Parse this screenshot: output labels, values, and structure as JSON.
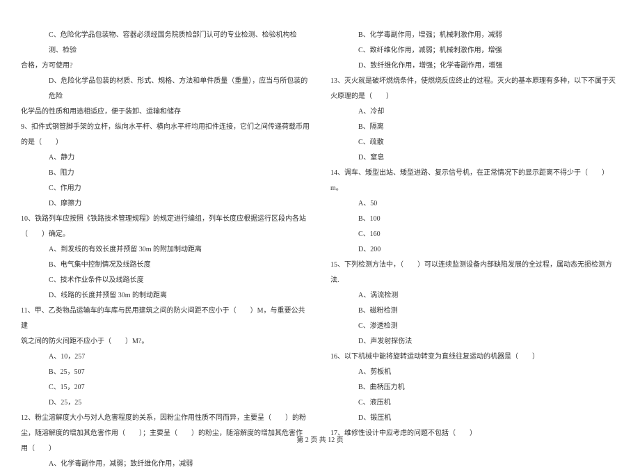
{
  "left_column": [
    {
      "type": "option",
      "text": "C、危险化学品包装物、容器必须经国务院质检部门认可的专业检测、检验机构检测、检验"
    },
    {
      "type": "question",
      "text": "合格，方可使用?"
    },
    {
      "type": "option",
      "text": "D、危险化学品包装的材质、形式、规格、方法和单件质量（重量），应当与所包装的危险"
    },
    {
      "type": "question",
      "text": "化学品的性质和用途相适应，便于装卸、运输和储存"
    },
    {
      "type": "question",
      "text": "9、扣件式钢管脚手架的立杆，纵向水平杆、横向水平杆均用扣件连接，它们之间传递荷载币用"
    },
    {
      "type": "question",
      "text": "的是（　　）"
    },
    {
      "type": "option",
      "text": "A、静力"
    },
    {
      "type": "option",
      "text": "B、阻力"
    },
    {
      "type": "option",
      "text": "C、作用力"
    },
    {
      "type": "option",
      "text": "D、摩擦力"
    },
    {
      "type": "question",
      "text": "10、铁路列车应按照《铁路技术管理规程》的规定进行编组，列车长度应根据运行区段内各站"
    },
    {
      "type": "question",
      "text": "（　　）确定。"
    },
    {
      "type": "option",
      "text": "A、到发线的有效长度并预留 30m 的附加制动距离"
    },
    {
      "type": "option",
      "text": "B、电气集中控制情况及线路长度"
    },
    {
      "type": "option",
      "text": "C、技术作业条件以及线路长度"
    },
    {
      "type": "option",
      "text": "D、线路的长度并预留 30m 的制动距离"
    },
    {
      "type": "question",
      "text": "11、甲、乙类物品运输车的车库与民用建筑之间的防火间距不应小于（　　）M，与重要公共建"
    },
    {
      "type": "question",
      "text": "筑之间的防火间距不应小于（　　）M?。"
    },
    {
      "type": "option",
      "text": "A、10，257"
    },
    {
      "type": "option",
      "text": "B、25，507"
    },
    {
      "type": "option",
      "text": "C、15，207"
    },
    {
      "type": "option",
      "text": "D、25，25"
    },
    {
      "type": "question",
      "text": "12、粉尘溶解度大小与对人危害程度的关系，因粉尘作用性质不同而异，主要呈（　　）的粉"
    },
    {
      "type": "question",
      "text": "尘，随溶解度的增加其危害作用（　　）；主要呈（　　）的粉尘，随溶解度的增加其危害作"
    },
    {
      "type": "question",
      "text": "用（　　）"
    },
    {
      "type": "option",
      "text": "A、化学毒副作用，减弱；致纤维化作用，减弱"
    }
  ],
  "right_column": [
    {
      "type": "option",
      "text": "B、化学毒副作用，增强；机械刺激作用，减弱"
    },
    {
      "type": "option",
      "text": "C、致纤维化作用，减弱；机械刺激作用，增强"
    },
    {
      "type": "option",
      "text": "D、致纤维化作用，增强；化学毒副作用，增强"
    },
    {
      "type": "question",
      "text": "13、灭火就是破坏燃烧条件，使燃烧反应终止的过程。灭火的基本原理有多种，以下不属于灭"
    },
    {
      "type": "question",
      "text": "火原理的是（　　）"
    },
    {
      "type": "option",
      "text": "A、冷却"
    },
    {
      "type": "option",
      "text": "B、隔离"
    },
    {
      "type": "option",
      "text": "C、疏散"
    },
    {
      "type": "option",
      "text": "D、窒息"
    },
    {
      "type": "question",
      "text": "14、调车、矮型出站、矮型进路、复示信号机，在正常情况下的显示距离不得少于（　　）m。"
    },
    {
      "type": "option",
      "text": "A、50"
    },
    {
      "type": "option",
      "text": "B、100"
    },
    {
      "type": "option",
      "text": "C、160"
    },
    {
      "type": "option",
      "text": "D、200"
    },
    {
      "type": "question",
      "text": "15、下列检测方法中，（　　）可以连续监测设备内部缺陷发展的全过程，属动态无损检测方"
    },
    {
      "type": "question",
      "text": "法."
    },
    {
      "type": "option",
      "text": "A、涡流检测"
    },
    {
      "type": "option",
      "text": "B、磁粉检测"
    },
    {
      "type": "option",
      "text": "C、渗透检测"
    },
    {
      "type": "option",
      "text": "D、声发射探伤法"
    },
    {
      "type": "question",
      "text": "16、以下机械中能将旋转运动转变为直线往复运动的机器是（　　）"
    },
    {
      "type": "option",
      "text": "A、剪板机"
    },
    {
      "type": "option",
      "text": "B、曲柄压力机"
    },
    {
      "type": "option",
      "text": "C、液压机"
    },
    {
      "type": "option",
      "text": "D、锻压机"
    },
    {
      "type": "question",
      "text": "17、维修性设计中应考虑的问题不包括（　　）"
    }
  ],
  "footer": "第 2 页 共 12 页"
}
